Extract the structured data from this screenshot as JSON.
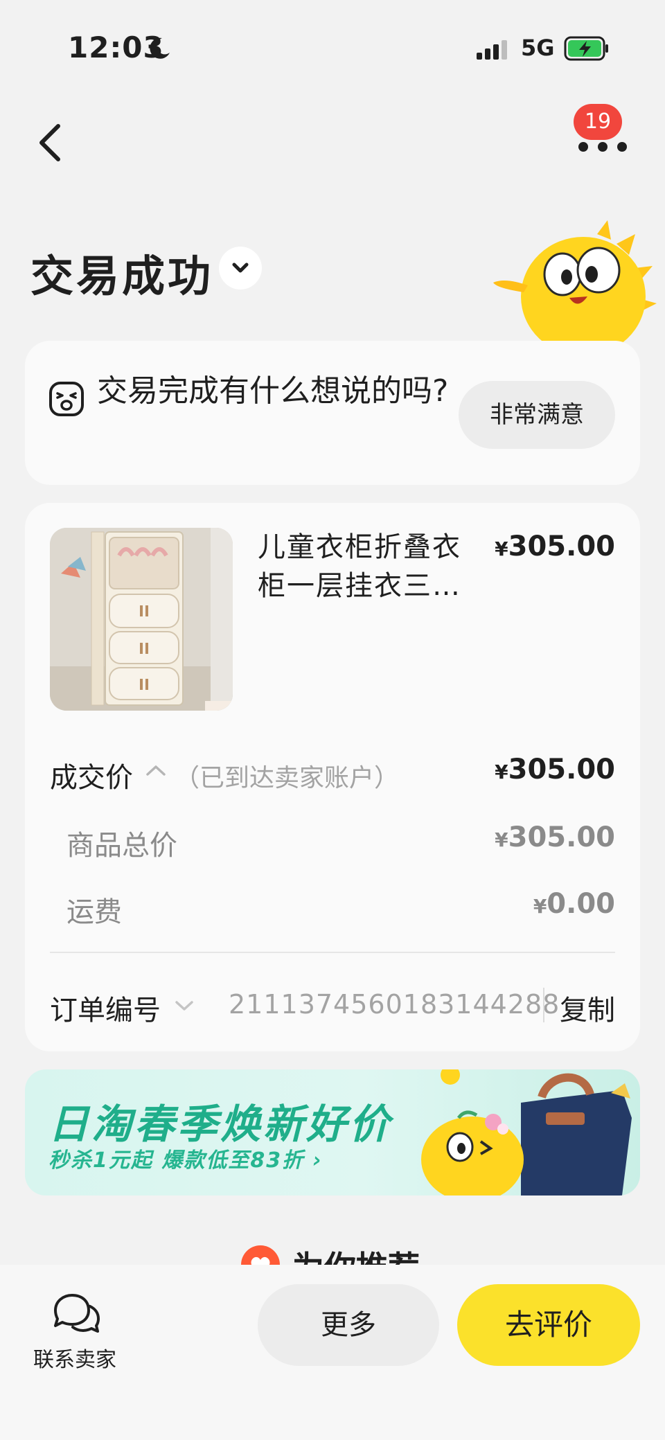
{
  "status_bar": {
    "time": "12:03",
    "network": "5G"
  },
  "nav": {
    "badge_count": "19"
  },
  "page": {
    "title": "交易成功"
  },
  "feedback": {
    "prompt": "交易完成有什么想说的吗?",
    "button_label": "非常满意"
  },
  "order": {
    "product_name": "儿童衣柜折叠衣柜一层挂衣三…",
    "currency": "¥",
    "product_price": "305.00",
    "deal_label": "成交价",
    "deal_note": "（已到达卖家账户）",
    "deal_price": "305.00",
    "goods_total_label": "商品总价",
    "goods_total": "305.00",
    "shipping_label": "运费",
    "shipping": "0.00",
    "order_no_label": "订单编号",
    "order_no": "2111374560183144288",
    "copy_label": "复制"
  },
  "banner": {
    "title": "日淘春季焕新好价",
    "subtitle": "秒杀1元起 爆款低至83折 ›"
  },
  "recommend": {
    "title": "为你推荐"
  },
  "bottom_bar": {
    "contact_label": "联系卖家",
    "more_label": "更多",
    "review_label": "去评价"
  },
  "colors": {
    "accent_yellow": "#fbe12b",
    "badge_red": "#f1463d",
    "promo_green": "#1fae8a",
    "battery_green": "#35c759"
  },
  "icons": [
    "moon-icon",
    "signal-icon",
    "battery-charging-icon",
    "back-arrow-icon",
    "more-dots-icon",
    "chevron-down-icon",
    "feedback-face-icon",
    "chevron-up-icon",
    "heart-icon",
    "chat-icon"
  ]
}
